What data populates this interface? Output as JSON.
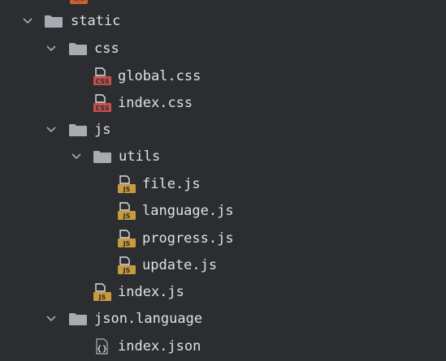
{
  "colors": {
    "background": "#2b2d30",
    "text": "#dfe1e5",
    "folder": "#a7abb2",
    "chevron": "#a7abb2",
    "css_badge": "#c94f4f",
    "js_badge": "#c79a3b",
    "json_badge": "#9aa0a6"
  },
  "tree": {
    "static": {
      "label": "static",
      "icon": "folder-icon"
    },
    "css": {
      "label": "css",
      "icon": "folder-icon"
    },
    "global_css": {
      "label": "global.css",
      "icon": "css-file-icon",
      "badge": "CSS"
    },
    "index_css": {
      "label": "index.css",
      "icon": "css-file-icon",
      "badge": "CSS"
    },
    "js": {
      "label": "js",
      "icon": "folder-icon"
    },
    "utils": {
      "label": "utils",
      "icon": "folder-icon"
    },
    "file_js": {
      "label": "file.js",
      "icon": "js-file-icon",
      "badge": "JS"
    },
    "language_js": {
      "label": "language.js",
      "icon": "js-file-icon",
      "badge": "JS"
    },
    "progress_js": {
      "label": "progress.js",
      "icon": "js-file-icon",
      "badge": "JS"
    },
    "update_js": {
      "label": "update.js",
      "icon": "js-file-icon",
      "badge": "JS"
    },
    "index_js": {
      "label": "index.js",
      "icon": "js-file-icon",
      "badge": "JS"
    },
    "json_language": {
      "label": "json.language",
      "icon": "folder-icon"
    },
    "index_json": {
      "label": "index.json",
      "icon": "json-file-icon"
    }
  }
}
